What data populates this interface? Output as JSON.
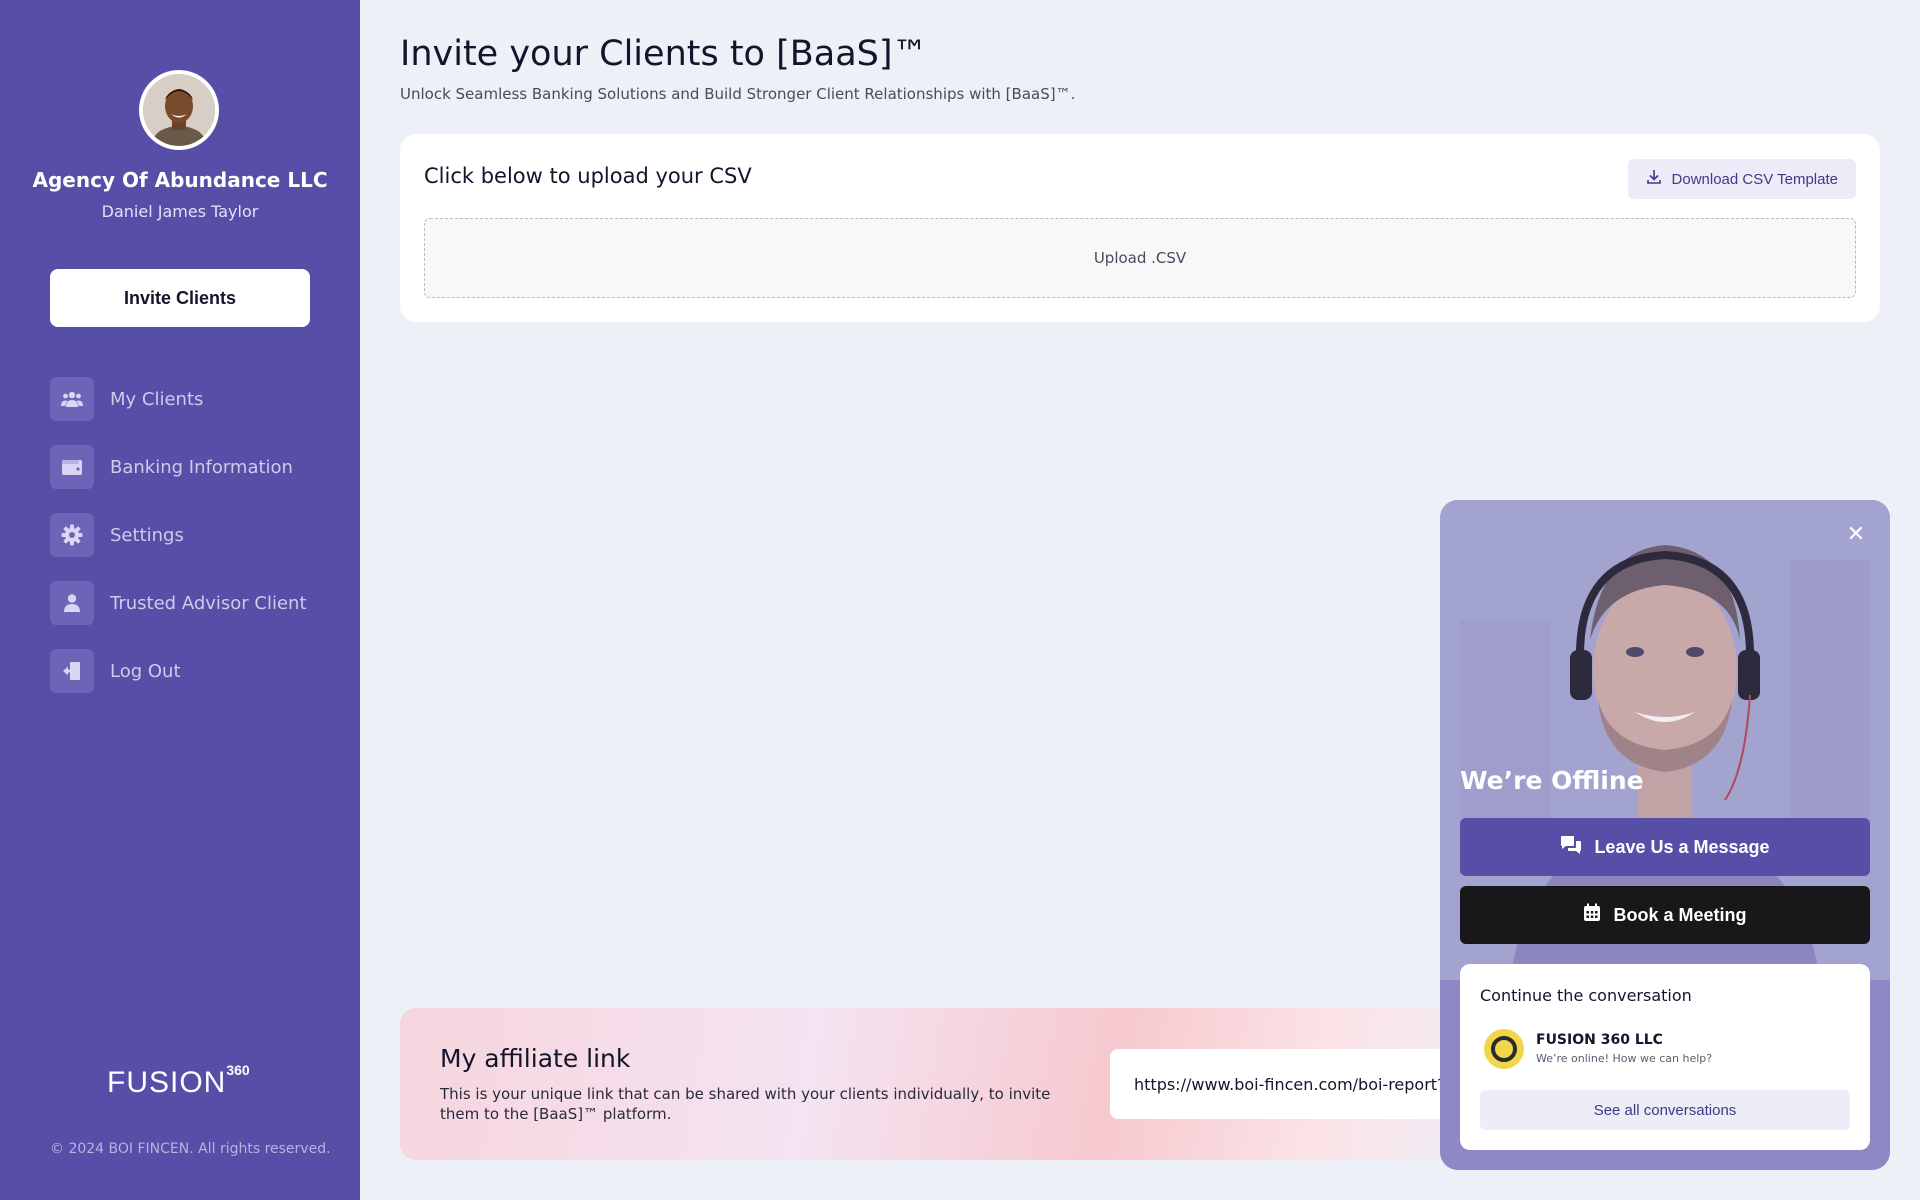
{
  "sidebar": {
    "agency_name": "Agency Of Abundance LLC",
    "user_name": "Daniel James Taylor",
    "invite_label": "Invite Clients",
    "items": [
      {
        "label": "My Clients",
        "icon": "users-icon"
      },
      {
        "label": "Banking Information",
        "icon": "wallet-icon"
      },
      {
        "label": "Settings",
        "icon": "gear-icon"
      },
      {
        "label": "Trusted Advisor Client",
        "icon": "user-icon"
      },
      {
        "label": "Log Out",
        "icon": "logout-icon"
      }
    ],
    "logo_text": "FUSION",
    "logo_sup": "360",
    "copyright": "© 2024 BOI FINCEN. All rights reserved."
  },
  "main": {
    "title": "Invite your Clients to [BaaS]™",
    "subtitle": "Unlock Seamless Banking Solutions and Build Stronger Client Relationships with [BaaS]™.",
    "upload": {
      "title": "Click below to upload your CSV",
      "download_label": "Download CSV Template",
      "dropzone_label": "Upload .CSV"
    },
    "affiliate": {
      "title": "My affiliate link",
      "description": "This is your unique link that can be shared with your clients individually, to invite them to the [BaaS]™ platform.",
      "link": "https://www.boi-fincen.com/boi-report?affiliate="
    }
  },
  "chat": {
    "status": "We’re Offline",
    "message_label": "Leave Us a Message",
    "meeting_label": "Book a Meeting",
    "continue_title": "Continue the conversation",
    "company": "FUSION 360 LLC",
    "company_status": "We’re online! How we can help?",
    "see_all_label": "See all conversations"
  },
  "colors": {
    "sidebar": "#574ea8",
    "accent": "#574ea8",
    "background": "#eef0f8",
    "meeting_button": "#18181b"
  }
}
